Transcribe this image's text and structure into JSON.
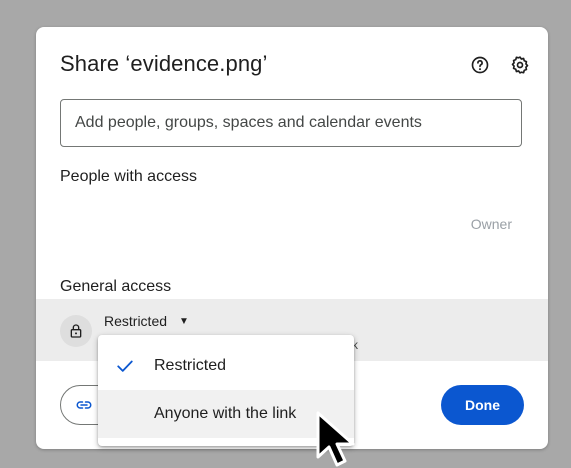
{
  "dialog": {
    "title": "Share ‘evidence.png’",
    "help_icon": "help-circle-icon",
    "settings_icon": "gear-icon",
    "add_people_placeholder": "Add people, groups, spaces and calendar events",
    "people_with_access_label": "People with access",
    "owner_role": "Owner",
    "general_access_label": "General access",
    "access_selected": "Restricted",
    "access_description_fragment": "k",
    "copy_link_icon": "link-icon",
    "done_label": "Done"
  },
  "access_menu": {
    "items": [
      {
        "label": "Restricted",
        "selected": true
      },
      {
        "label": "Anyone with the link",
        "selected": false
      }
    ]
  },
  "colors": {
    "primary": "#0b57d0",
    "overlay": "#a8a8a8",
    "hover_row": "#ececec"
  }
}
